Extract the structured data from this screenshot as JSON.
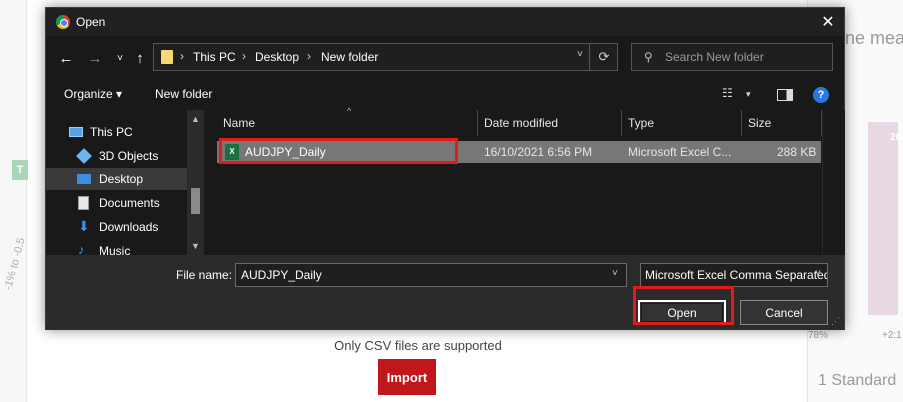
{
  "background": {
    "heading_fragment": "ne mea",
    "bar_label": "20",
    "green_badge": "T",
    "rotated_label": "-1% to -0.5",
    "pct_left": "78%",
    "pct_right": "+2:1",
    "standard_fragment": "1 Standard",
    "note": "Only CSV files are supported",
    "import_label": "Import"
  },
  "dialog": {
    "title": "Open",
    "close": "✕",
    "nav": {
      "back": "←",
      "forward": "→",
      "recent": "˅",
      "up": "↑"
    },
    "address": {
      "crumbs": [
        "This PC",
        "Desktop",
        "New folder"
      ],
      "separator": "›",
      "refresh": "⟳",
      "dropdown": "˅"
    },
    "search": {
      "placeholder": "Search New folder",
      "icon": "⚲"
    },
    "toolbar": {
      "organize": "Organize ▾",
      "new_folder": "New folder",
      "view_icon": "☷",
      "view_dd": "▾",
      "help": "?"
    },
    "navpane": {
      "items": [
        {
          "label": "This PC",
          "icon": "computer-icon"
        },
        {
          "label": "3D Objects",
          "icon": "cube-icon"
        },
        {
          "label": "Desktop",
          "icon": "desktop-icon"
        },
        {
          "label": "Documents",
          "icon": "document-icon"
        },
        {
          "label": "Downloads",
          "icon": "download-icon"
        },
        {
          "label": "Music",
          "icon": "music-icon"
        }
      ],
      "scroll_up": "▲",
      "scroll_down": "▼"
    },
    "columns": {
      "name": "Name",
      "date": "Date modified",
      "type": "Type",
      "size": "Size",
      "sort": "^"
    },
    "files": [
      {
        "name": "AUDJPY_Daily",
        "date": "16/10/2021 6:56 PM",
        "type": "Microsoft Excel C...",
        "size": "288 KB",
        "icon": "X"
      }
    ],
    "filename": {
      "label": "File name:",
      "value": "AUDJPY_Daily",
      "dropdown": "˅"
    },
    "filetype": {
      "value": "Microsoft Excel Comma Separated",
      "dropdown": "˅"
    },
    "buttons": {
      "open": "Open",
      "cancel": "Cancel"
    },
    "grip": "⋰"
  },
  "colors": {
    "highlight": "#e21a1a",
    "import": "#c0161c",
    "excel": "#1d6f42",
    "help": "#2b78e4"
  }
}
